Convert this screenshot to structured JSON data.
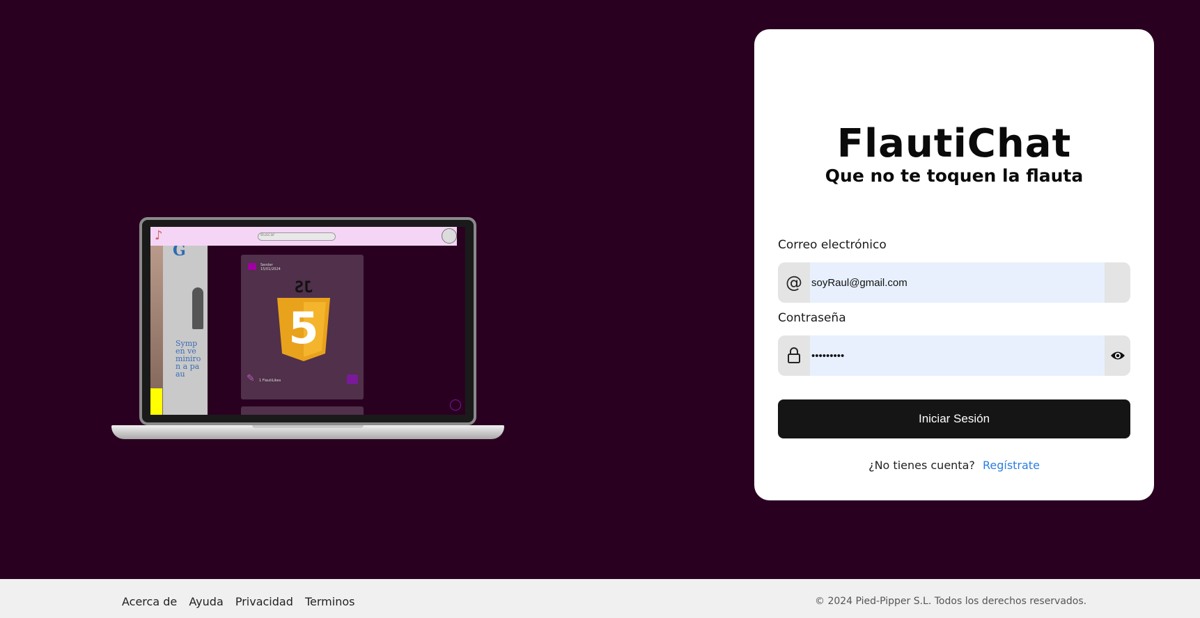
{
  "mockup": {
    "search_placeholder": "Buscar",
    "post_user": "Sender",
    "post_date": "15/01/2024",
    "post_likes": "1 FlautiLikes",
    "side_text": "Symp en ve miniro n a pa au",
    "js_label": "JS",
    "js_digit": "5"
  },
  "brand": {
    "title": "FlautiChat",
    "tagline": "Que no te toquen la flauta"
  },
  "form": {
    "email_label": "Correo electrónico",
    "email_value": "soyRaul@gmail.com",
    "password_label": "Contraseña",
    "password_value": "•••••••••",
    "submit_label": "Iniciar Sesión",
    "signup_prompt": "¿No tienes cuenta?",
    "signup_link": "Regístrate"
  },
  "footer": {
    "links": [
      "Acerca de",
      "Ayuda",
      "Privacidad",
      "Terminos"
    ],
    "copyright": "© 2024 Pied-Pipper S.L. Todos los derechos reservados."
  },
  "colors": {
    "background": "#2a0021",
    "card": "#ffffff",
    "button": "#151515",
    "link": "#2a7de1",
    "input_fill": "#e8f0fe"
  }
}
